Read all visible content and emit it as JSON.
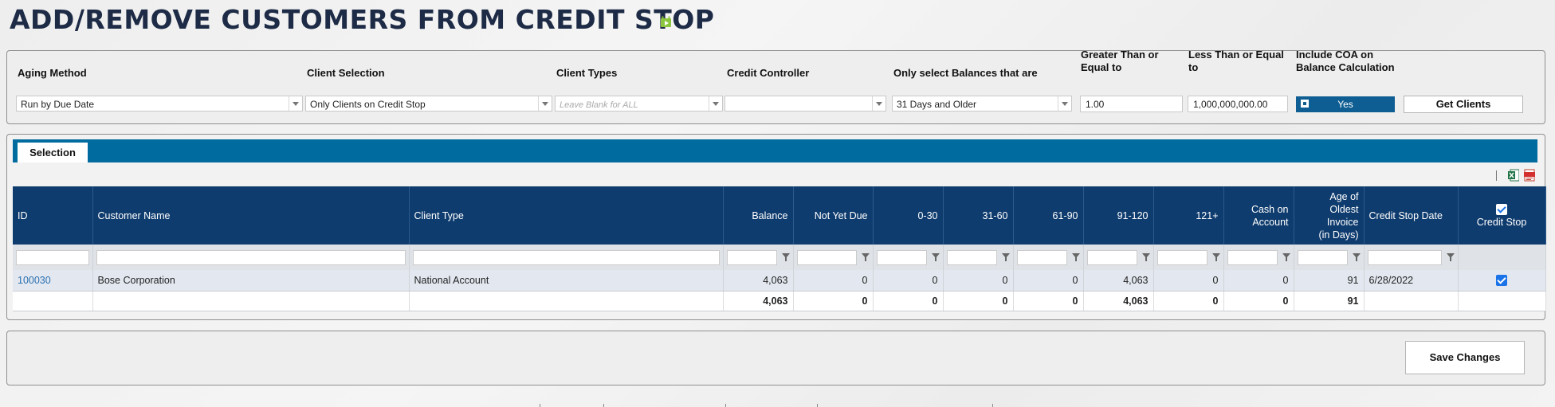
{
  "page": {
    "title": "ADD/REMOVE CUSTOMERS FROM CREDIT STOP",
    "title_icon": "video-icon"
  },
  "filters": {
    "aging_method": {
      "label": "Aging Method",
      "value": "Run by Due Date"
    },
    "client_selection": {
      "label": "Client Selection",
      "value": "Only Clients on Credit Stop"
    },
    "client_types": {
      "label": "Client Types",
      "placeholder": "Leave Blank for ALL"
    },
    "credit_controller": {
      "label": "Credit Controller",
      "value": ""
    },
    "balances": {
      "label": "Only select Balances that are",
      "value": "31 Days and Older"
    },
    "greater_than": {
      "label_line1": "Greater Than or",
      "label_line2": "Equal to",
      "value": "1.00"
    },
    "less_than": {
      "label_line1": "Less Than or Equal",
      "label_line2": "to",
      "value": "1,000,000,000.00"
    },
    "include_coa": {
      "label_line1": "Include COA on",
      "label_line2": "Balance Calculation",
      "value": "Yes"
    },
    "get_clients_label": "Get Clients"
  },
  "tabs": [
    {
      "label": "Selection"
    }
  ],
  "toolbar": {
    "excel_icon": "excel-export-icon",
    "pdf_icon": "pdf-export-icon"
  },
  "grid": {
    "columns": {
      "id": "ID",
      "customer_name": "Customer Name",
      "client_type": "Client Type",
      "balance": "Balance",
      "not_yet_due": "Not Yet Due",
      "d0_30": "0-30",
      "d31_60": "31-60",
      "d61_90": "61-90",
      "d91_120": "91-120",
      "d121": "121+",
      "cash_l1": "Cash on",
      "cash_l2": "Account",
      "age_l1": "Age of",
      "age_l2": "Oldest",
      "age_l3": "Invoice",
      "age_l4": "(in Days)",
      "credit_stop_date": "Credit Stop Date",
      "credit_stop": "Credit Stop"
    },
    "rows": [
      {
        "id": "100030",
        "customer_name": "Bose Corporation",
        "client_type": "National Account",
        "balance": "4,063",
        "not_yet_due": "0",
        "d0_30": "0",
        "d31_60": "0",
        "d61_90": "0",
        "d91_120": "4,063",
        "d121": "0",
        "cash_on_account": "0",
        "age_oldest_invoice": "91",
        "credit_stop_date": "6/28/2022",
        "credit_stop": true
      }
    ],
    "totals": {
      "balance": "4,063",
      "not_yet_due": "0",
      "d0_30": "0",
      "d31_60": "0",
      "d61_90": "0",
      "d91_120": "4,063",
      "d121": "0",
      "cash_on_account": "0",
      "age_oldest_invoice": "91"
    }
  },
  "save_changes_label": "Save Changes",
  "colors": {
    "header_navy": "#0f3c6e",
    "tab_blue": "#006b9f",
    "toggle_blue": "#0f5e93",
    "title": "#1d2b46",
    "link": "#2a6fb0"
  }
}
